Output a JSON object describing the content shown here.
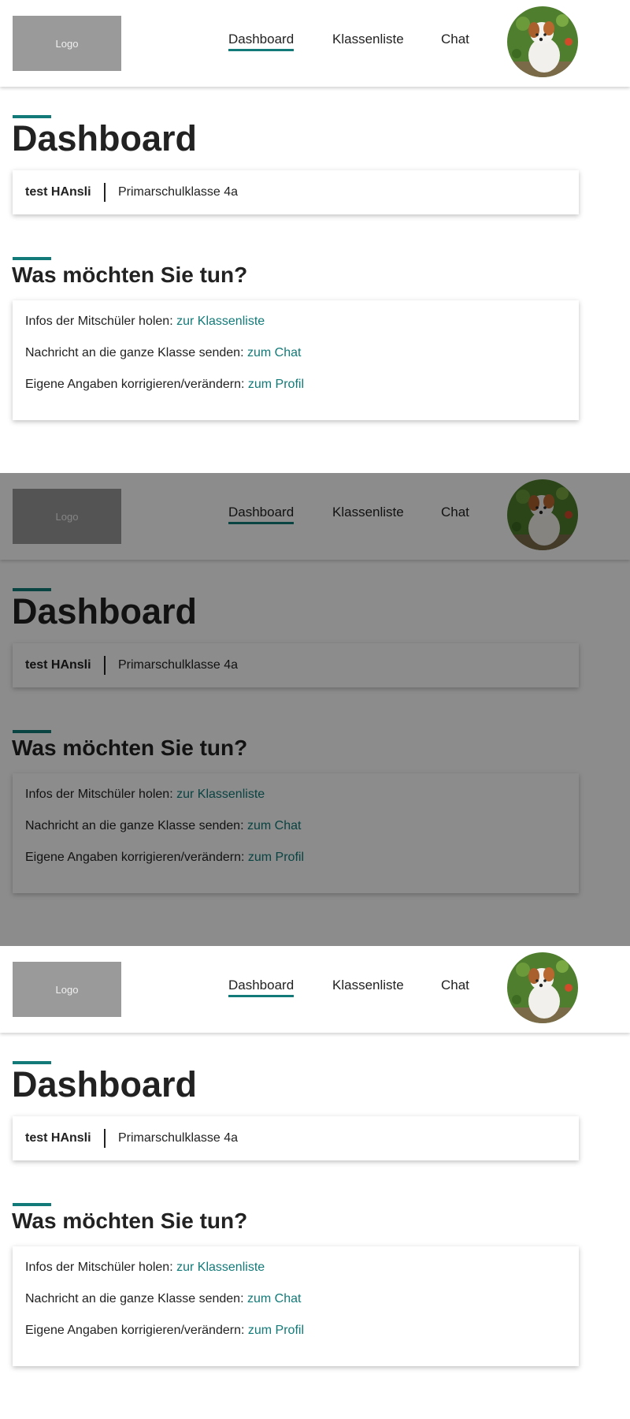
{
  "header": {
    "logo_text": "Logo",
    "nav": {
      "dashboard": "Dashboard",
      "klassenliste": "Klassenliste",
      "chat": "Chat"
    }
  },
  "main": {
    "title": "Dashboard",
    "user": {
      "name": "test HAnsli",
      "class": "Primarschulklasse 4a"
    },
    "subtitle": "Was möchten Sie tun?",
    "actions": [
      {
        "text": "Infos der Mitschüler holen:",
        "link": "zur Klassenliste"
      },
      {
        "text": "Nachricht an die ganze Klasse senden:",
        "link": "zum Chat"
      },
      {
        "text": "Eigene Angaben korrigieren/verändern:",
        "link": "zum Profil"
      }
    ]
  },
  "colors": {
    "accent": "#127a78",
    "logo_bg": "#9a9a9a"
  }
}
